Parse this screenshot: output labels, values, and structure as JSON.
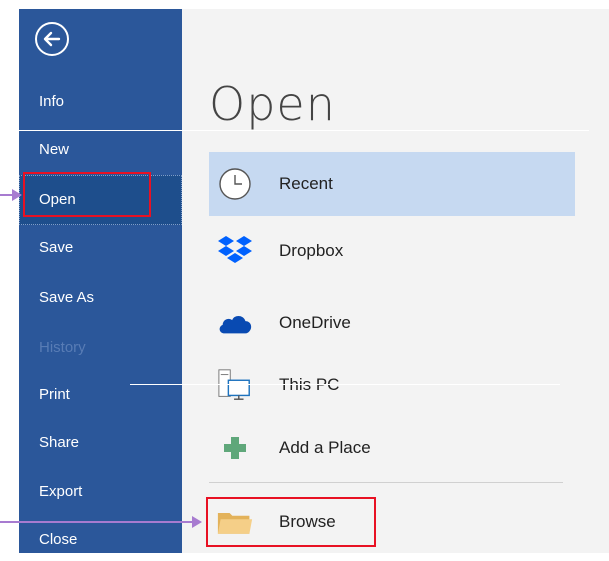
{
  "sidebar": {
    "items": [
      {
        "label": "Info"
      },
      {
        "label": "New"
      },
      {
        "label": "Open"
      },
      {
        "label": "Save"
      },
      {
        "label": "Save As"
      },
      {
        "label": "History"
      },
      {
        "label": "Print"
      },
      {
        "label": "Share"
      },
      {
        "label": "Export"
      },
      {
        "label": "Close"
      }
    ]
  },
  "main": {
    "title": "Open",
    "places": [
      {
        "label": "Recent",
        "icon": "clock-icon"
      },
      {
        "label": "Dropbox",
        "icon": "dropbox-icon"
      },
      {
        "label": "OneDrive",
        "icon": "cloud-icon"
      },
      {
        "label": "This PC",
        "icon": "computer-icon"
      },
      {
        "label": "Add a Place",
        "icon": "plus-icon"
      },
      {
        "label": "Browse",
        "icon": "folder-icon"
      }
    ]
  },
  "colors": {
    "sidebar": "#2b579a",
    "selected_sidebar": "#1e4e8c",
    "selected_place": "#c6d9f1",
    "highlight_box": "#e81123",
    "annotation_arrow": "#a77bd0"
  }
}
